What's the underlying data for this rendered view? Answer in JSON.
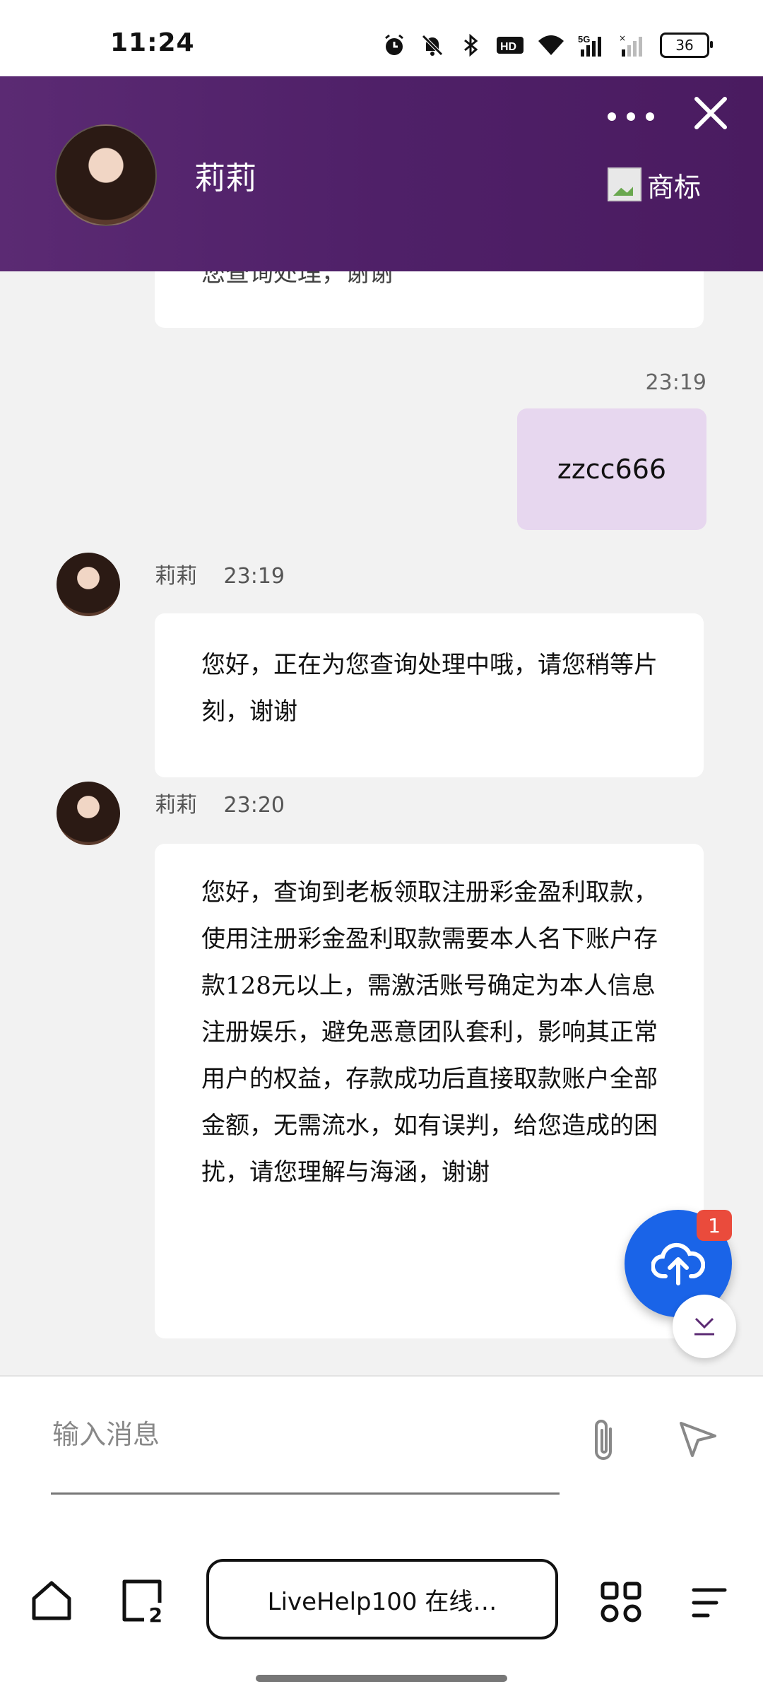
{
  "status_bar": {
    "time": "11:24",
    "battery": "36"
  },
  "header": {
    "agent_name": "莉莉",
    "logo_alt_text": "商标"
  },
  "messages": {
    "top_partial_text": "您查询处理，谢谢",
    "user_time": "23:19",
    "user_text": "zzcc666",
    "agent1_name": "莉莉",
    "agent1_time": "23:19",
    "agent1_text": "您好，正在为您查询处理中哦，请您稍等片刻，谢谢",
    "agent2_name": "莉莉",
    "agent2_time": "23:20",
    "agent2_text": "您好，查询到老板领取注册彩金盈利取款，使用注册彩金盈利取款需要本人名下账户存款128元以上，需激活账号确定为本人信息注册娱乐，避免恶意团队套利，影响其正常用户的权益，存款成功后直接取款账户全部金额，无需流水，如有误判，给您造成的困扰，请您理解与海涵，谢谢"
  },
  "fab": {
    "badge_count": "1"
  },
  "input": {
    "placeholder": "输入消息"
  },
  "browser": {
    "address": "LiveHelp100 在线…",
    "tab_count": "2"
  },
  "colors": {
    "header_purple": "#52216a",
    "user_bubble": "#e7d7ef",
    "fab_blue": "#1a64e8",
    "badge_red": "#ea4b3c"
  }
}
